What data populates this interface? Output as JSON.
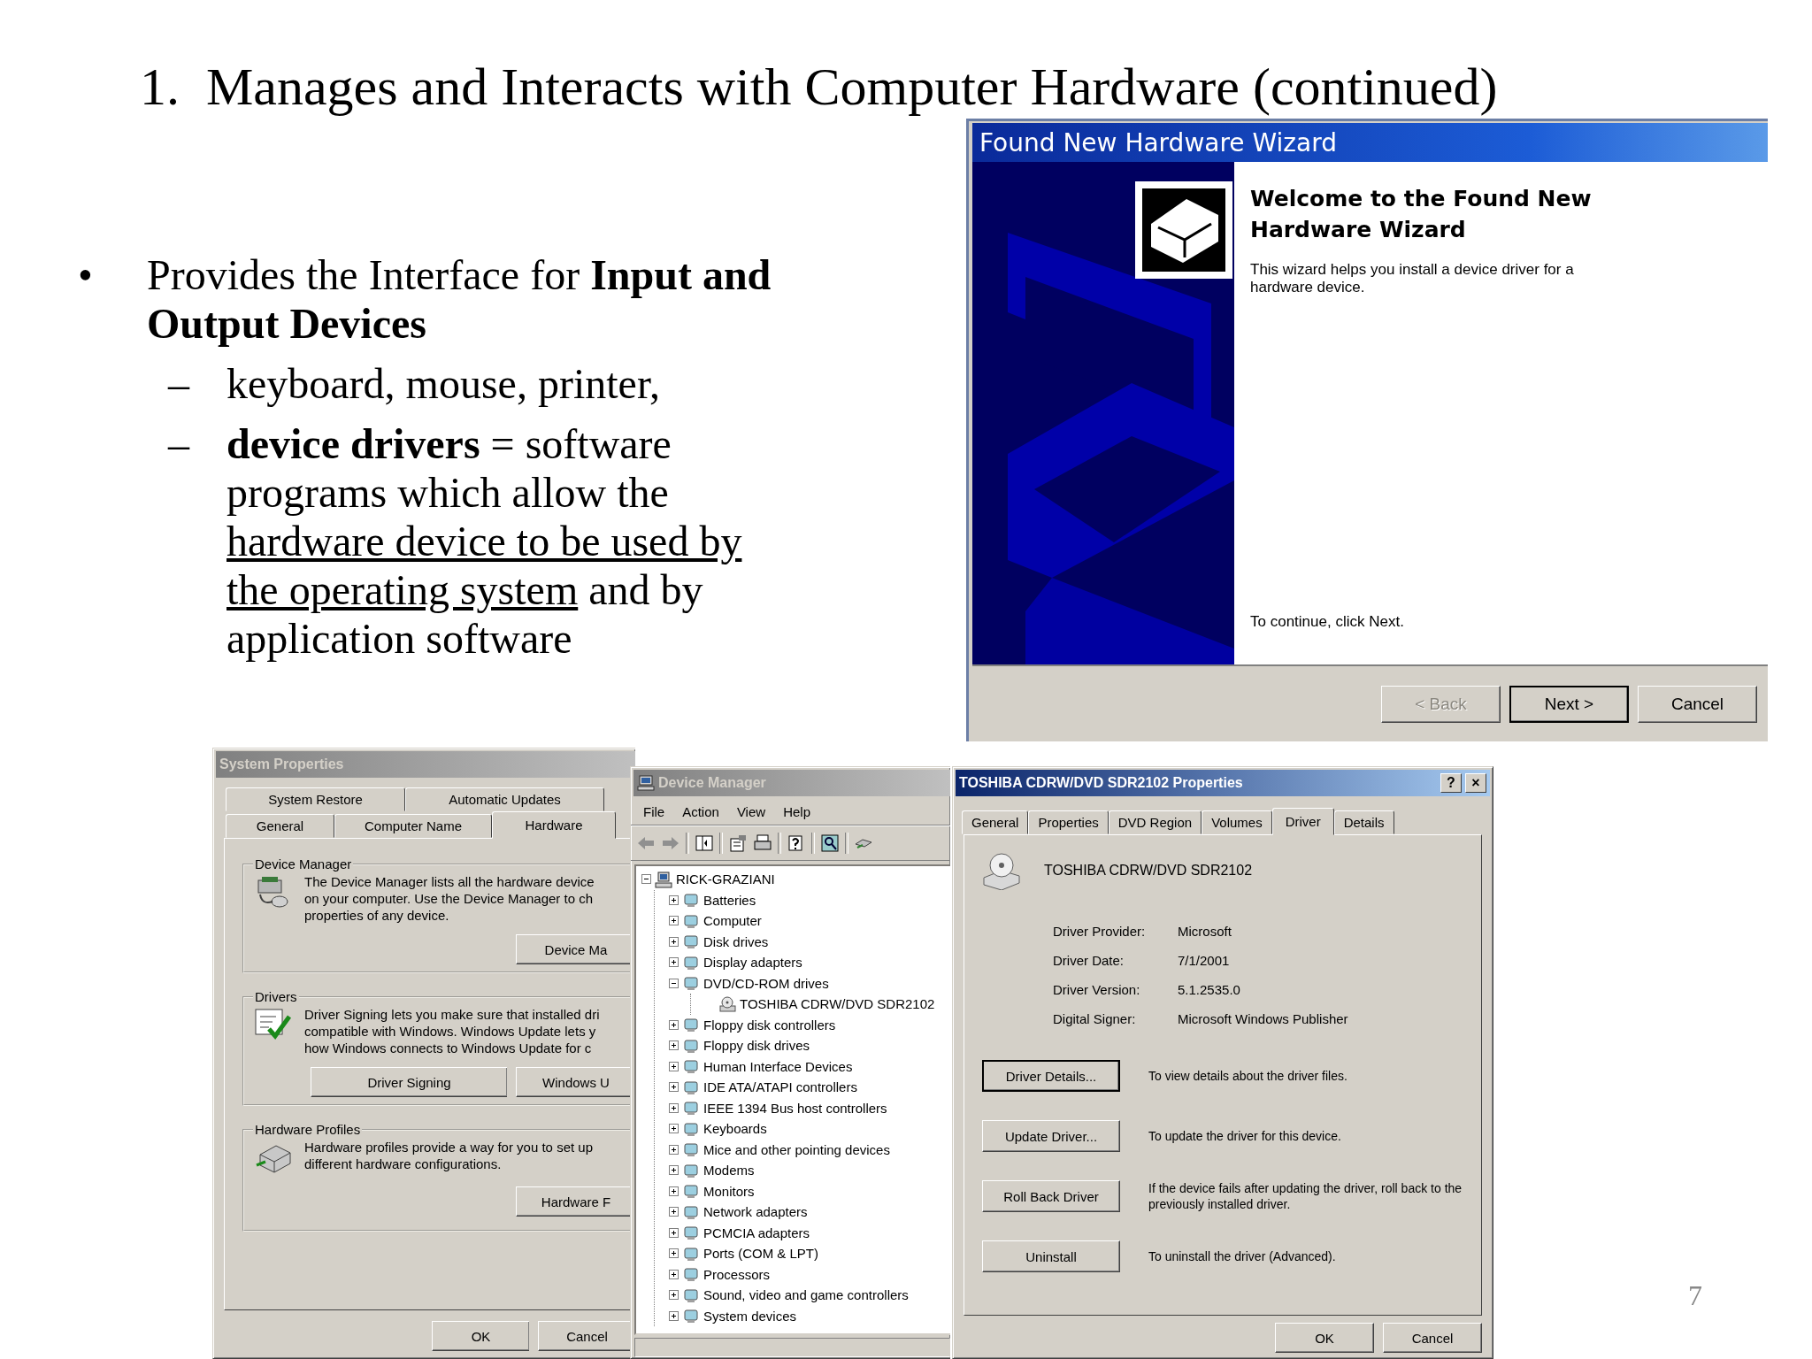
{
  "slide": {
    "title": "1.  Manages and Interacts with Computer Hardware (continued)",
    "page_number": "7"
  },
  "bullets": [
    {
      "marker": "•",
      "segments": [
        {
          "text": "Provides the Interface for **Input and Output Devices**",
          "underline": false
        }
      ],
      "children": [
        {
          "marker": "–",
          "segments": [
            {
              "text": "keyboard, mouse, printer,",
              "underline": false
            }
          ]
        },
        {
          "marker": "–",
          "segments": [
            {
              "text": "**device drivers** = software programs which allow the ",
              "underline": false
            },
            {
              "text": "hardware device to be used by the operating system",
              "underline": true
            },
            {
              "text": " and by application software",
              "underline": false
            }
          ]
        }
      ]
    }
  ],
  "wizard": {
    "title": "Found New Hardware Wizard",
    "heading": "Welcome to the Found New Hardware Wizard",
    "intro": "This wizard helps you install a device driver for a hardware device.",
    "footer": "To continue, click Next.",
    "buttons": [
      {
        "label": "< Back",
        "disabled": true,
        "default": false
      },
      {
        "label": "Next >",
        "disabled": false,
        "default": true
      },
      {
        "label": "Cancel",
        "disabled": false,
        "default": false
      }
    ]
  },
  "system_properties": {
    "title": "System Properties",
    "tab_rows": [
      [
        {
          "label": "System Restore",
          "selected": false
        },
        {
          "label": "Automatic Updates",
          "selected": false
        }
      ],
      [
        {
          "label": "General",
          "selected": false
        },
        {
          "label": "Computer Name",
          "selected": false
        },
        {
          "label": "Hardware",
          "selected": true
        }
      ]
    ],
    "groups": [
      {
        "kind": "device-manager",
        "title": "Device Manager",
        "text": "The Device Manager lists all the hardware device\non your computer. Use the Device Manager to ch\nproperties of any device.",
        "buttons": [
          "Device Ma"
        ]
      },
      {
        "kind": "drivers",
        "title": "Drivers",
        "text": "Driver Signing lets you make sure that installed dri\ncompatible with Windows. Windows Update lets y\nhow Windows connects to Windows Update for c",
        "buttons": [
          "Driver Signing",
          "Windows U"
        ]
      },
      {
        "kind": "profiles",
        "title": "Hardware Profiles",
        "text": "Hardware profiles provide a way for you to set up\ndifferent hardware configurations.",
        "buttons": [
          "Hardware F"
        ]
      }
    ],
    "buttons": [
      "OK",
      "Cancel"
    ]
  },
  "device_manager": {
    "title": "Device Manager",
    "menu": [
      "File",
      "Action",
      "View",
      "Help"
    ],
    "tree": [
      {
        "label": "RICK-GRAZIANI",
        "expanded": true,
        "children": [
          {
            "label": "Batteries",
            "expanded": false
          },
          {
            "label": "Computer",
            "expanded": false
          },
          {
            "label": "Disk drives",
            "expanded": false
          },
          {
            "label": "Display adapters",
            "expanded": false
          },
          {
            "label": "DVD/CD-ROM drives",
            "expanded": true,
            "children": [
              {
                "label": "TOSHIBA CDRW/DVD SDR2102"
              }
            ]
          },
          {
            "label": "Floppy disk controllers",
            "expanded": false
          },
          {
            "label": "Floppy disk drives",
            "expanded": false
          },
          {
            "label": "Human Interface Devices",
            "expanded": false
          },
          {
            "label": "IDE ATA/ATAPI controllers",
            "expanded": false
          },
          {
            "label": "IEEE 1394 Bus host controllers",
            "expanded": false
          },
          {
            "label": "Keyboards",
            "expanded": false
          },
          {
            "label": "Mice and other pointing devices",
            "expanded": false
          },
          {
            "label": "Modems",
            "expanded": false
          },
          {
            "label": "Monitors",
            "expanded": false
          },
          {
            "label": "Network adapters",
            "expanded": false
          },
          {
            "label": "PCMCIA adapters",
            "expanded": false
          },
          {
            "label": "Ports (COM & LPT)",
            "expanded": false
          },
          {
            "label": "Processors",
            "expanded": false
          },
          {
            "label": "Sound, video and game controllers",
            "expanded": false
          },
          {
            "label": "System devices",
            "expanded": false
          }
        ]
      }
    ]
  },
  "properties": {
    "title": "TOSHIBA CDRW/DVD SDR2102 Properties",
    "title_buttons": [
      "?",
      "×"
    ],
    "tabs": [
      {
        "label": "General",
        "selected": false
      },
      {
        "label": "Properties",
        "selected": false
      },
      {
        "label": "DVD Region",
        "selected": false
      },
      {
        "label": "Volumes",
        "selected": false
      },
      {
        "label": "Driver",
        "selected": true
      },
      {
        "label": "Details",
        "selected": false
      }
    ],
    "device_name": "TOSHIBA CDRW/DVD SDR2102",
    "fields": [
      {
        "label": "Driver Provider:",
        "value": "Microsoft"
      },
      {
        "label": "Driver Date:",
        "value": "7/1/2001"
      },
      {
        "label": "Driver Version:",
        "value": "5.1.2535.0"
      },
      {
        "label": "Digital Signer:",
        "value": "Microsoft Windows Publisher"
      }
    ],
    "actions": [
      {
        "button": "Driver Details...",
        "description": "To view details about the driver files.",
        "default": true
      },
      {
        "button": "Update Driver...",
        "description": "To update the driver for this device.",
        "default": false
      },
      {
        "button": "Roll Back Driver",
        "description": "If the device fails after updating the driver, roll back to the previously installed driver.",
        "default": false
      },
      {
        "button": "Uninstall",
        "description": "To uninstall the driver (Advanced).",
        "default": false
      }
    ],
    "buttons": [
      "OK",
      "Cancel"
    ]
  }
}
